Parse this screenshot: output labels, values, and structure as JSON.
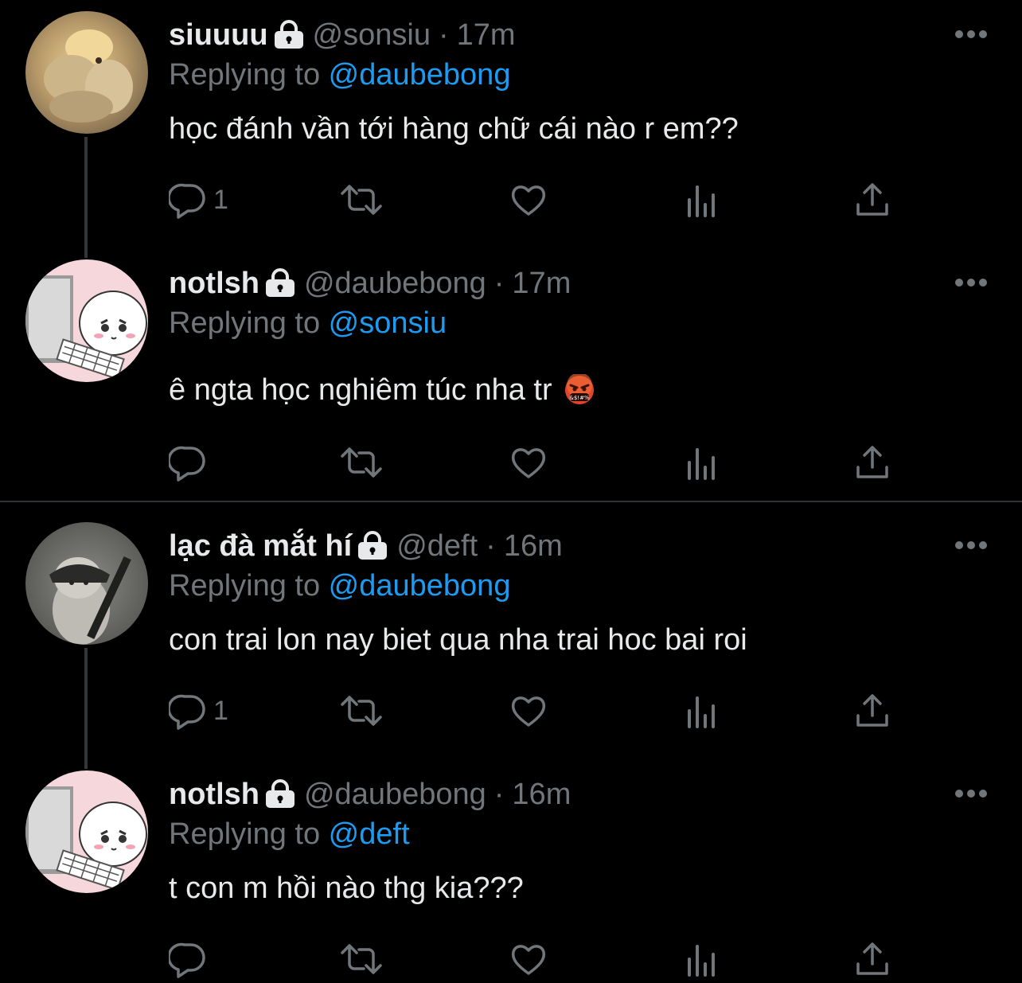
{
  "tweets": [
    {
      "name": "siuuuu",
      "handle": "@sonsiu",
      "time": "17m",
      "replying_prefix": "Replying to ",
      "replying_to": "@daubebong",
      "text": "học đánh vần tới hàng chữ cái nào r em??",
      "reply_count": "1",
      "has_emoji": false
    },
    {
      "name": "notlsh",
      "handle": "@daubebong",
      "time": "17m",
      "replying_prefix": "Replying to ",
      "replying_to": "@sonsiu",
      "text": "ê ngta học nghiêm túc nha tr",
      "reply_count": "",
      "has_emoji": true,
      "emoji": "face-with-symbols-on-mouth"
    },
    {
      "name": "lạc đà mắt hí",
      "handle": "@deft",
      "time": "16m",
      "replying_prefix": "Replying to ",
      "replying_to": "@daubebong",
      "text": "con trai lon nay biet qua nha trai hoc bai roi",
      "reply_count": "1",
      "has_emoji": false
    },
    {
      "name": "notlsh",
      "handle": "@daubebong",
      "time": "16m",
      "replying_prefix": "Replying to ",
      "replying_to": "@deft",
      "text": "t con m hồi nào thg kia???",
      "reply_count": "",
      "has_emoji": false
    }
  ],
  "dot_separator": "·",
  "colors": {
    "background": "#000000",
    "text": "#e7e9ea",
    "muted": "#71767b",
    "link": "#1d9bf0",
    "divider": "#2f3336"
  },
  "icons": [
    "lock-icon",
    "more-icon",
    "reply-icon",
    "retweet-icon",
    "like-icon",
    "views-icon",
    "share-icon"
  ]
}
